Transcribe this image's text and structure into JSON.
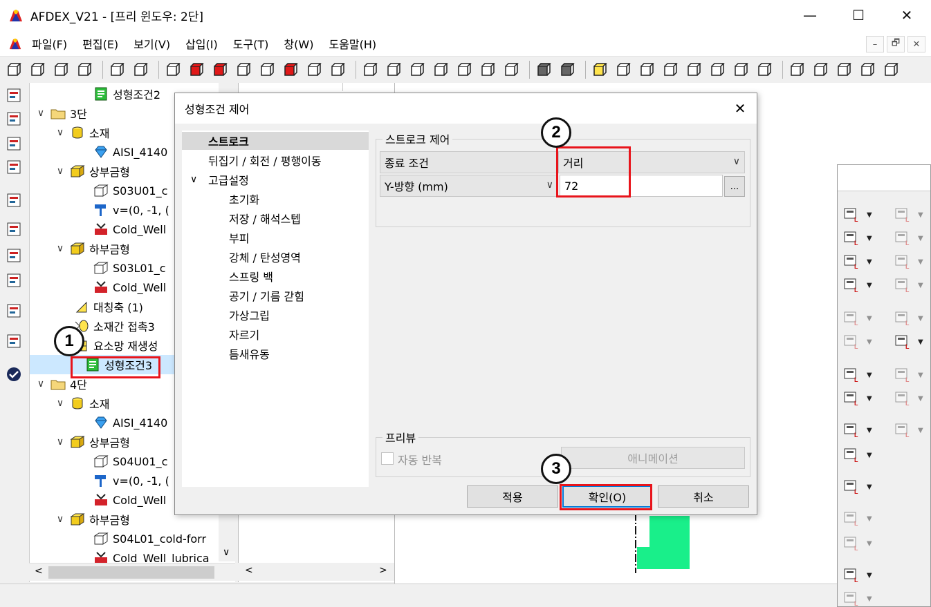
{
  "window": {
    "title": "AFDEX_V21 - [프리 윈도우: 2단]",
    "minimize": "—",
    "maximize": "☐",
    "close": "✕"
  },
  "menu": {
    "items": [
      "파일(F)",
      "편집(E)",
      "보기(V)",
      "삽입(I)",
      "도구(T)",
      "창(W)",
      "도움말(H)"
    ],
    "mdi": [
      "–",
      "🗗",
      "✕"
    ]
  },
  "tree": {
    "rows": [
      {
        "label": "성형조건2",
        "chev": "",
        "indent": 2,
        "icon": "green-doc"
      },
      {
        "label": "3단",
        "chev": "∨",
        "indent": 0,
        "icon": "folder"
      },
      {
        "label": "소재",
        "chev": "∨",
        "indent": 1,
        "icon": "yellow-cylinder"
      },
      {
        "label": "AISI_4140",
        "chev": "",
        "indent": 2,
        "icon": "blue-gem"
      },
      {
        "label": "상부금형",
        "chev": "∨",
        "indent": 1,
        "icon": "yellow-die"
      },
      {
        "label": "S03U01_c",
        "chev": "",
        "indent": 2,
        "icon": "outline-die"
      },
      {
        "label": "v=(0, -1, (",
        "chev": "",
        "indent": 2,
        "icon": "hammer"
      },
      {
        "label": "Cold_Well",
        "chev": "",
        "indent": 2,
        "icon": "lubricant"
      },
      {
        "label": "하부금형",
        "chev": "∨",
        "indent": 1,
        "icon": "yellow-die"
      },
      {
        "label": "S03L01_c",
        "chev": "",
        "indent": 2,
        "icon": "outline-die"
      },
      {
        "label": "Cold_Well",
        "chev": "",
        "indent": 2,
        "icon": "lubricant"
      },
      {
        "label": "대칭축 (1)",
        "chev": "",
        "indent": 1,
        "icon": "symmetry"
      },
      {
        "label": "소재간 접촉3",
        "chev": "",
        "indent": 1,
        "icon": "contact"
      },
      {
        "label": "요소망 재생성",
        "chev": "",
        "indent": 1,
        "icon": "mesh"
      },
      {
        "label": "성형조건3",
        "chev": "",
        "indent": 1,
        "icon": "green-doc",
        "selected": true
      },
      {
        "label": "4단",
        "chev": "∨",
        "indent": 0,
        "icon": "folder"
      },
      {
        "label": "소재",
        "chev": "∨",
        "indent": 1,
        "icon": "yellow-cylinder"
      },
      {
        "label": "AISI_4140",
        "chev": "",
        "indent": 2,
        "icon": "blue-gem"
      },
      {
        "label": "상부금형",
        "chev": "∨",
        "indent": 1,
        "icon": "yellow-die"
      },
      {
        "label": "S04U01_c",
        "chev": "",
        "indent": 2,
        "icon": "outline-die"
      },
      {
        "label": "v=(0, -1, (",
        "chev": "",
        "indent": 2,
        "icon": "hammer"
      },
      {
        "label": "Cold_Well",
        "chev": "",
        "indent": 2,
        "icon": "lubricant"
      },
      {
        "label": "하부금형",
        "chev": "∨",
        "indent": 1,
        "icon": "yellow-die"
      },
      {
        "label": "S04L01_cold-forr",
        "chev": "",
        "indent": 2,
        "icon": "outline-die"
      },
      {
        "label": "Cold_Well_lubrica",
        "chev": "",
        "indent": 2,
        "icon": "lubricant"
      }
    ]
  },
  "dialog": {
    "title": "성형조건 제어",
    "close": "✕",
    "nav": [
      {
        "label": "스트로크",
        "selected": true,
        "level": 0
      },
      {
        "label": "뒤집기 / 회전 / 평행이동",
        "level": 0
      },
      {
        "label": "고급설정",
        "level": 0,
        "chev": "∨"
      },
      {
        "label": "초기화",
        "level": 1
      },
      {
        "label": "저장 / 해석스텝",
        "level": 1
      },
      {
        "label": "부피",
        "level": 1
      },
      {
        "label": "강체 / 탄성영역",
        "level": 1
      },
      {
        "label": "스프링 백",
        "level": 1
      },
      {
        "label": "공기 / 기름 갇힘",
        "level": 1
      },
      {
        "label": "가상그립",
        "level": 1
      },
      {
        "label": "자르기",
        "level": 1
      },
      {
        "label": "틈새유동",
        "level": 1
      }
    ],
    "stroke_group": "스트로크 제어",
    "end_condition_label": "종료 조건",
    "end_condition_value": "거리",
    "direction_value": "Y-방향 (mm)",
    "distance_value": "72",
    "browse_button": "...",
    "preview_group": "프리뷰",
    "auto_repeat_label": "자동 반복",
    "animation_button": "애니메이션",
    "apply_button": "적용",
    "ok_button": "확인(O)",
    "cancel_button": "취소"
  },
  "annotations": {
    "step1": "1",
    "step2": "2",
    "step3": "3",
    "highlight_color": "#e8141b"
  }
}
